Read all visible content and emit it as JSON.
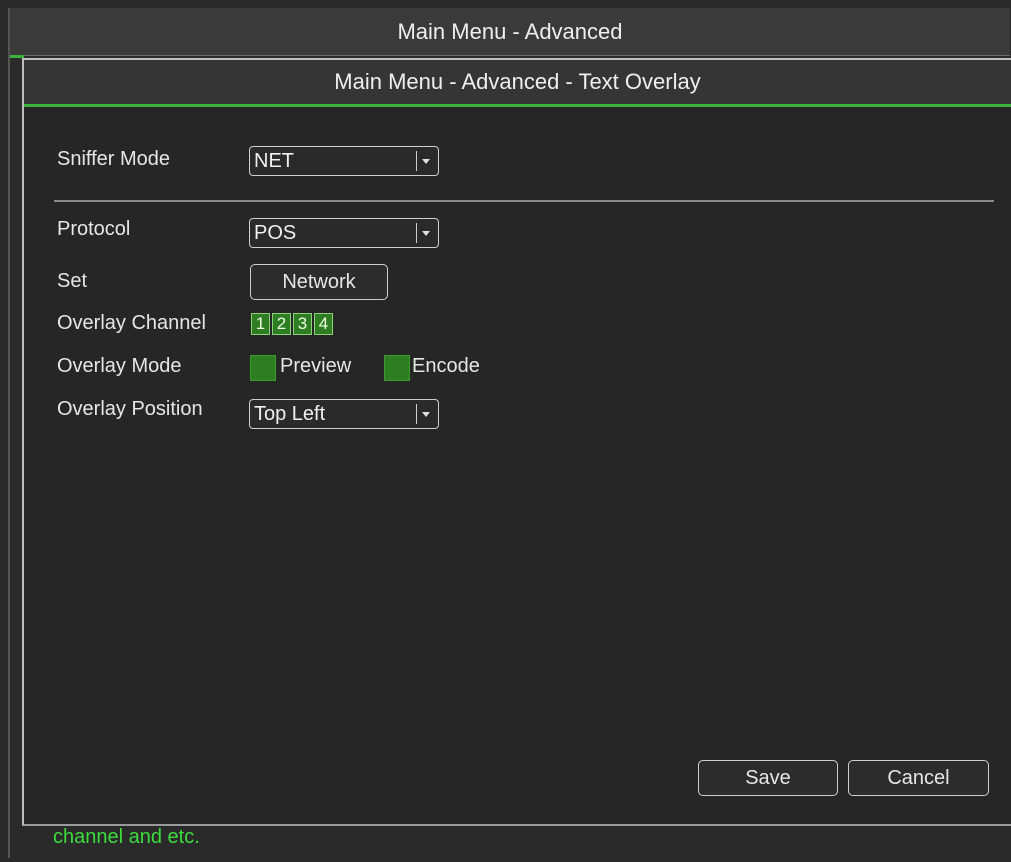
{
  "outer_window": {
    "title": "Main Menu - Advanced"
  },
  "dialog": {
    "title": "Main Menu - Advanced - Text Overlay",
    "sniffer_mode": {
      "label": "Sniffer Mode",
      "value": "NET"
    },
    "protocol": {
      "label": "Protocol",
      "value": "POS"
    },
    "set": {
      "label": "Set",
      "button_label": "Network"
    },
    "overlay_channel": {
      "label": "Overlay Channel",
      "channels": [
        "1",
        "2",
        "3",
        "4"
      ]
    },
    "overlay_mode": {
      "label": "Overlay Mode",
      "preview_label": "Preview",
      "encode_label": "Encode",
      "preview_checked": true,
      "encode_checked": true
    },
    "overlay_position": {
      "label": "Overlay Position",
      "value": "Top Left"
    },
    "save_label": "Save",
    "cancel_label": "Cancel"
  },
  "status_bar": {
    "help_text": "channel and etc."
  },
  "colors": {
    "accent_green": "#3cb43c",
    "help_text_green": "#3cdc3c",
    "channel_green": "#2f7d22"
  }
}
